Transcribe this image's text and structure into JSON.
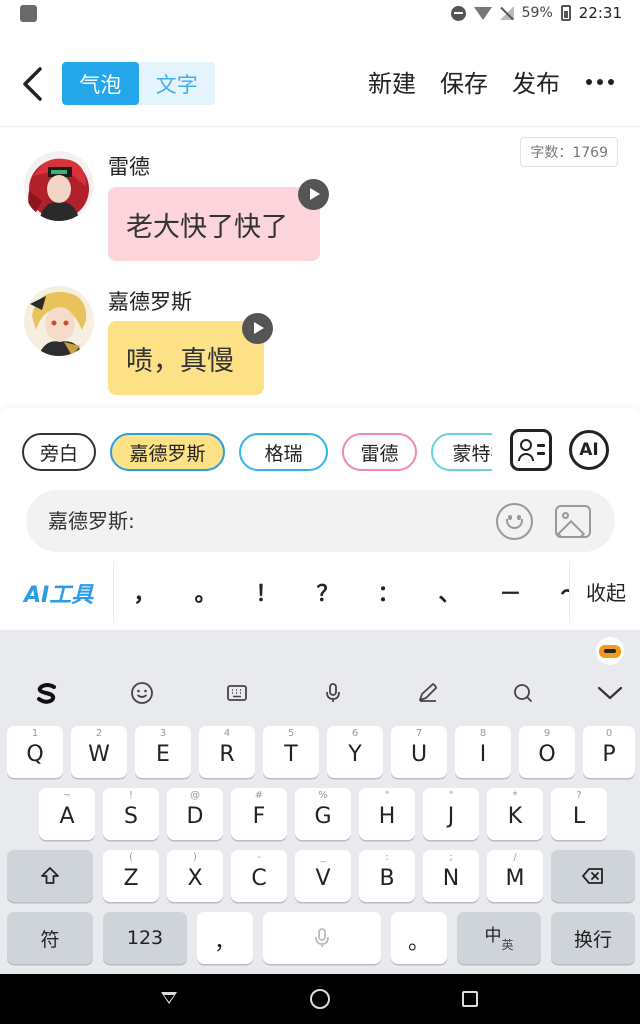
{
  "status_bar": {
    "battery": "59%",
    "time": "22:31"
  },
  "header": {
    "tabs": [
      {
        "label": "气泡",
        "active": true
      },
      {
        "label": "文字",
        "active": false
      }
    ],
    "actions": {
      "new": "新建",
      "save": "保存",
      "publish": "发布"
    }
  },
  "chat": {
    "word_count": "字数：1769",
    "messages": [
      {
        "name": "雷德",
        "text": "老大快了快了",
        "bubble_color": "#fbd4dc"
      },
      {
        "name": "嘉德罗斯",
        "text": "啧，真慢",
        "bubble_color": "#fde187"
      }
    ]
  },
  "editor": {
    "characters": [
      {
        "label": "旁白",
        "border": "#333333",
        "bg": "#ffffff"
      },
      {
        "label": "嘉德罗斯",
        "border": "#2a9de6",
        "bg": "#fde187"
      },
      {
        "label": "格瑞",
        "border": "#2fb5f0",
        "bg": "#ffffff"
      },
      {
        "label": "雷德",
        "border": "#f08aa7",
        "bg": "#ffffff"
      },
      {
        "label": "蒙特祖",
        "border": "#6bd0e2",
        "bg": "#ffffff"
      }
    ],
    "ai_button": "AI",
    "input_text": "嘉德罗斯:",
    "ai_tools": "AI工具",
    "punctuation": [
      "，",
      "。",
      "！",
      "？",
      "：",
      "、",
      "－",
      "～"
    ],
    "collapse": "收起"
  },
  "keyboard": {
    "row1": [
      {
        "k": "Q",
        "s": "1"
      },
      {
        "k": "W",
        "s": "2"
      },
      {
        "k": "E",
        "s": "3"
      },
      {
        "k": "R",
        "s": "4"
      },
      {
        "k": "T",
        "s": "5"
      },
      {
        "k": "Y",
        "s": "6"
      },
      {
        "k": "U",
        "s": "7"
      },
      {
        "k": "I",
        "s": "8"
      },
      {
        "k": "O",
        "s": "9"
      },
      {
        "k": "P",
        "s": "0"
      }
    ],
    "row2": [
      {
        "k": "A",
        "s": "~"
      },
      {
        "k": "S",
        "s": "!"
      },
      {
        "k": "D",
        "s": "@"
      },
      {
        "k": "F",
        "s": "#"
      },
      {
        "k": "G",
        "s": "%"
      },
      {
        "k": "H",
        "s": "\""
      },
      {
        "k": "J",
        "s": "\""
      },
      {
        "k": "K",
        "s": "*"
      },
      {
        "k": "L",
        "s": "?"
      }
    ],
    "row3": [
      {
        "k": "Z",
        "s": "("
      },
      {
        "k": "X",
        "s": ")"
      },
      {
        "k": "C",
        "s": "-"
      },
      {
        "k": "V",
        "s": "_"
      },
      {
        "k": "B",
        "s": ":"
      },
      {
        "k": "N",
        "s": ";"
      },
      {
        "k": "M",
        "s": "/"
      }
    ],
    "symbols": "符",
    "numbers": "123",
    "comma": "，",
    "period": "。",
    "lang_main": "中",
    "lang_sub": "英",
    "enter": "换行"
  }
}
